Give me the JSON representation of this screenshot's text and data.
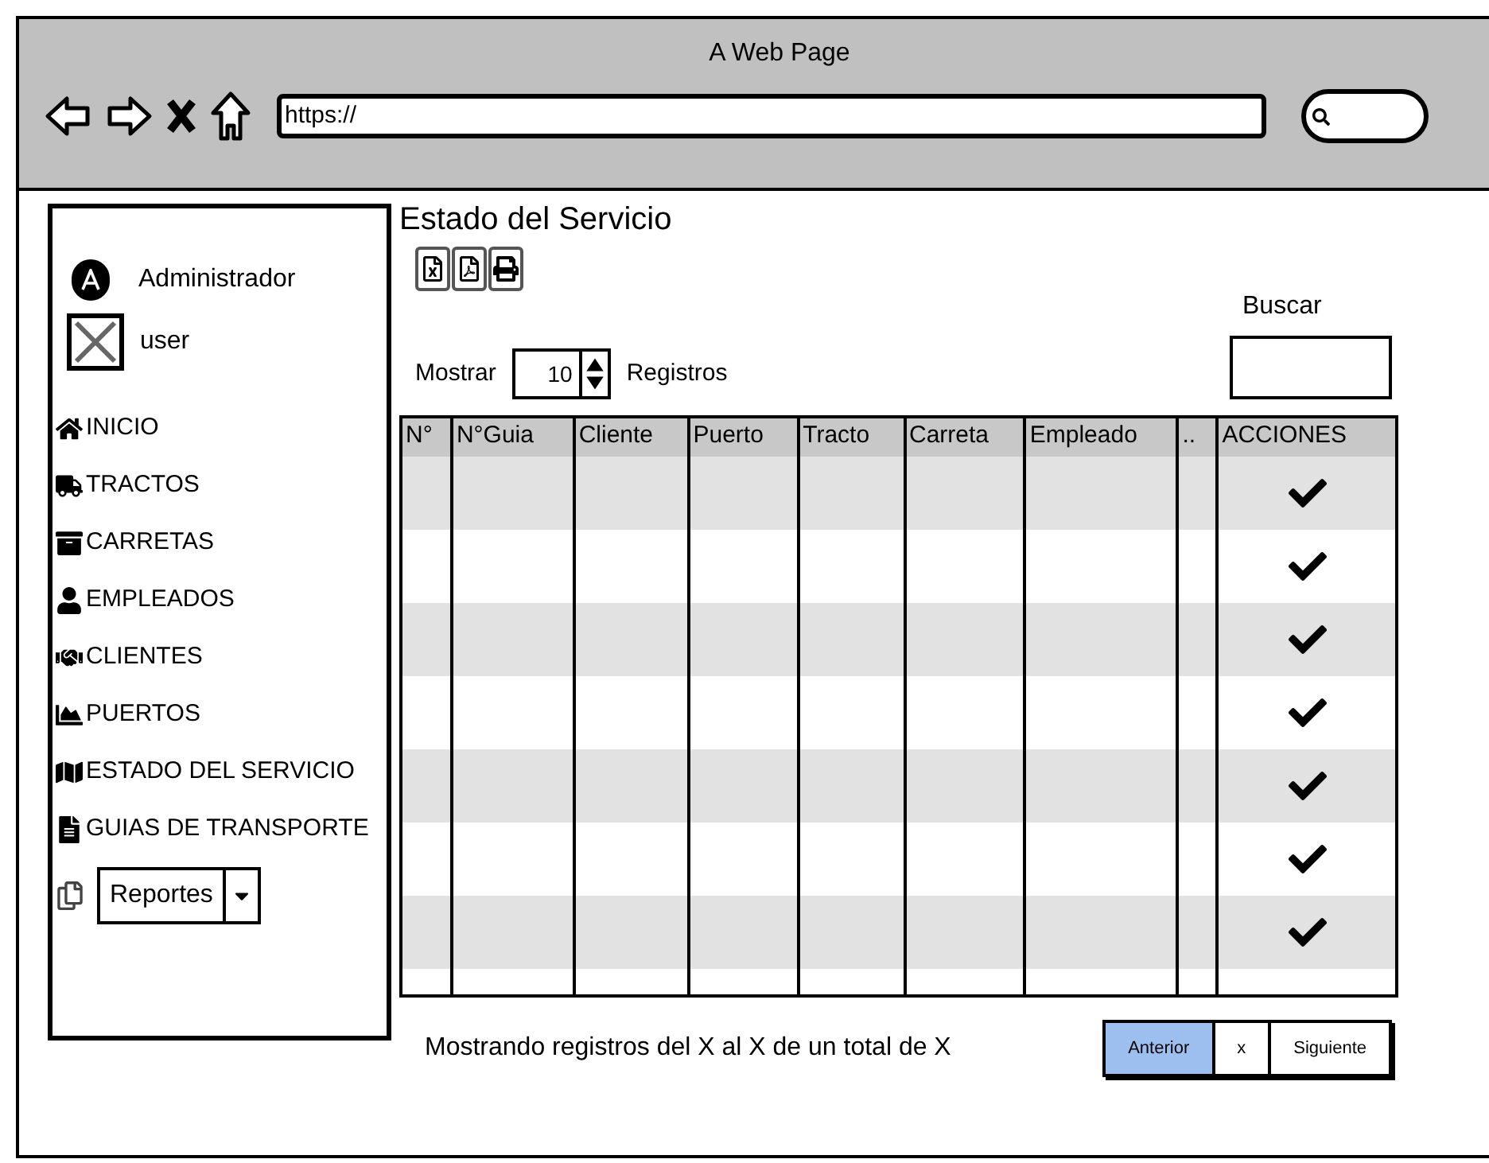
{
  "browser": {
    "title": "A Web Page",
    "url": "https://"
  },
  "sidebar": {
    "user_role": "Administrador",
    "user_name": "user",
    "items": [
      {
        "label": "INICIO",
        "kind": "home"
      },
      {
        "label": "TRACTOS",
        "kind": "truck"
      },
      {
        "label": "CARRETAS",
        "kind": "archive"
      },
      {
        "label": "EMPLEADOS",
        "kind": "person"
      },
      {
        "label": "CLIENTES",
        "kind": "handshake"
      },
      {
        "label": "PUERTOS",
        "kind": "chart"
      },
      {
        "label": "ESTADO DEL SERVICIO",
        "kind": "map"
      },
      {
        "label": "GUIAS DE TRANSPORTE",
        "kind": "file"
      }
    ],
    "reports_dropdown": "Reportes"
  },
  "main": {
    "title": "Estado del Servicio",
    "show_label": "Mostrar",
    "page_size": "10",
    "records_label": "Registros",
    "search_label": "Buscar",
    "table": {
      "columns": [
        "N°",
        "N°Guia",
        "Cliente",
        "Puerto",
        "Tracto",
        "Carreta",
        "Empleado",
        "..",
        "ACCIONES"
      ],
      "rows": [
        {
          "striped": true
        },
        {
          "striped": false
        },
        {
          "striped": true
        },
        {
          "striped": false
        },
        {
          "striped": true
        },
        {
          "striped": false
        },
        {
          "striped": true
        }
      ]
    },
    "summary": "Mostrando registros del X al X de un total de X",
    "pagination": [
      {
        "label": "Anterior",
        "selected": true
      },
      {
        "label": "x",
        "selected": false
      },
      {
        "label": "Siguiente",
        "selected": false
      }
    ]
  }
}
